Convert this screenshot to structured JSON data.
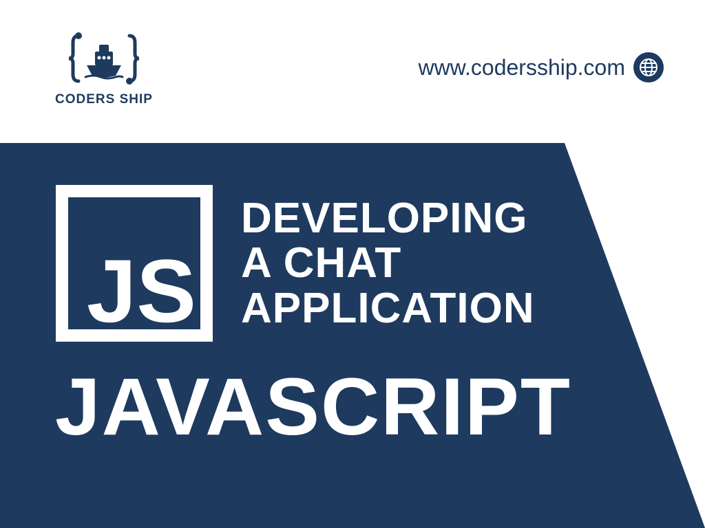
{
  "header": {
    "brand_name": "CODERS SHIP",
    "url": "www.codersship.com"
  },
  "banner": {
    "js_label": "JS",
    "title_line_1": "DEVELOPING",
    "title_line_2": "A CHAT",
    "title_line_3": "APPLICATION",
    "subtitle": "JAVASCRIPT"
  },
  "colors": {
    "primary": "#1e3a5f",
    "white": "#ffffff"
  }
}
